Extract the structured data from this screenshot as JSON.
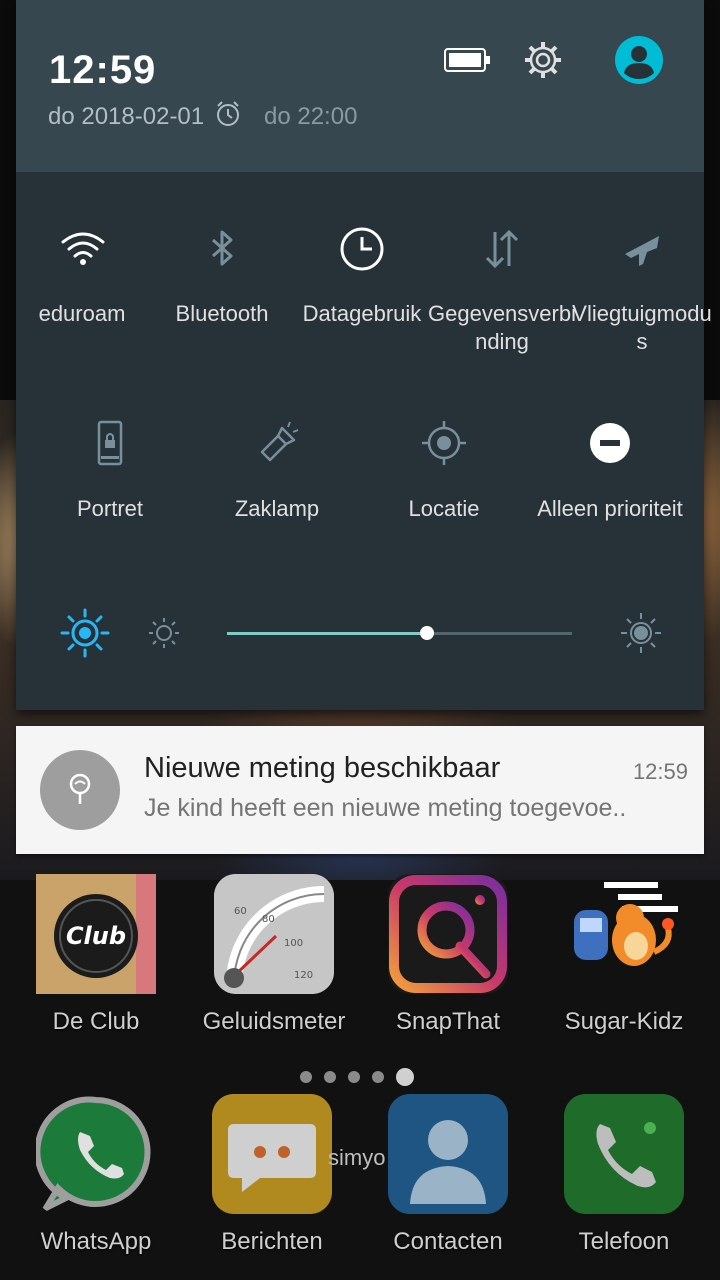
{
  "status": {
    "time": "12:59",
    "date": "do 2018-02-01",
    "next_alarm": "do 22:00",
    "icons": [
      "battery-icon",
      "settings-icon",
      "user-icon",
      "alarm-icon"
    ]
  },
  "quick_settings": {
    "tiles": [
      {
        "label": "eduroam",
        "icon": "wifi-icon",
        "active": true
      },
      {
        "label": "Bluetooth",
        "icon": "bluetooth-icon",
        "active": false
      },
      {
        "label": "Datagebruik",
        "icon": "data-usage-icon",
        "active": true
      },
      {
        "label": "Gegevensverbi\nnding",
        "icon": "mobile-data-icon",
        "active": false
      },
      {
        "label": "Vliegtuigmodu\ns",
        "icon": "airplane-icon",
        "active": false
      },
      {
        "label": "Portret",
        "icon": "portrait-lock-icon",
        "active": false
      },
      {
        "label": "Zaklamp",
        "icon": "flashlight-icon",
        "active": false
      },
      {
        "label": "Locatie",
        "icon": "location-icon",
        "active": false
      },
      {
        "label": "Alleen prioriteit",
        "icon": "priority-only-icon",
        "active": true
      }
    ],
    "brightness": {
      "auto": true,
      "level": 0.58
    },
    "accent_color": "#29b6f6"
  },
  "notification": {
    "title": "Nieuwe meting beschikbaar",
    "time": "12:59",
    "text": "Je kind heeft een nieuwe meting toegevoe..",
    "icon": "lollipop-icon"
  },
  "home": {
    "apps": [
      {
        "label": "De Club",
        "icon": "de-club-icon"
      },
      {
        "label": "Geluidsmeter",
        "icon": "sound-meter-icon"
      },
      {
        "label": "SnapThat",
        "icon": "snapthat-icon"
      },
      {
        "label": "Sugar-Kidz",
        "icon": "sugar-kidz-icon"
      }
    ],
    "page_dots": 5,
    "active_page": 4,
    "carrier": "simyo",
    "dock": [
      {
        "label": "WhatsApp",
        "icon": "whatsapp-icon"
      },
      {
        "label": "Berichten",
        "icon": "messages-icon"
      },
      {
        "label": "Contacten",
        "icon": "contacts-icon"
      },
      {
        "label": "Telefoon",
        "icon": "phone-icon"
      }
    ]
  }
}
